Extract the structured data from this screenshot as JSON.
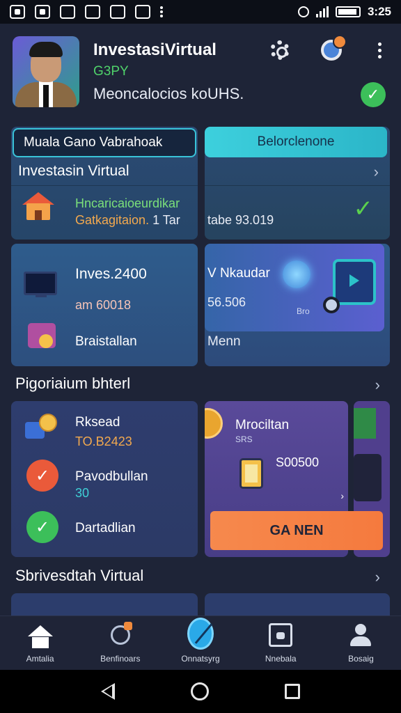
{
  "status_bar": {
    "time": "3:25"
  },
  "header": {
    "title": "InvestasiVirtual",
    "subtitle": "G3PY",
    "description": "Meoncalocios koUHS."
  },
  "cards": {
    "top_left": {
      "pill": "Muala Gano Vabrahoak",
      "title": "Investasin Virtual",
      "line1": "Hncaricaioeurdikar",
      "line2": "Gatkagitaion.",
      "line2_tail": "1 Tar"
    },
    "top_right": {
      "pill": "Belorclenone",
      "overflow": "tabe 93.019"
    },
    "mid_left": {
      "title": "Inves.2400",
      "value": "am 60018",
      "bottom": "Braistallan"
    },
    "mid_right": {
      "title": "V Nkaudar",
      "value": "56.506",
      "small": "Bro",
      "bottom": "Menn"
    }
  },
  "sections": {
    "section1": "Pigoriaium bhterl",
    "section2": "Sbrivesdtah Virtual"
  },
  "lower_cards": {
    "left": {
      "row1_title": "Rksead",
      "row1_value": "TO.B2423",
      "row2_title": "Pavodbullan",
      "row2_value": "30",
      "row3_title": "Dartadlian"
    },
    "middle": {
      "title": "Mrociltan",
      "small": "SRS",
      "value": "S00500"
    },
    "cta": "GA NEN"
  },
  "bottom_nav": [
    {
      "label": "Amtalia",
      "icon": "home-icon"
    },
    {
      "label": "Benfinoars",
      "icon": "rocket-icon"
    },
    {
      "label": "Onnatsyrg",
      "icon": "globe-icon"
    },
    {
      "label": "Nnebala",
      "icon": "wallet-icon"
    },
    {
      "label": "Bosaig",
      "icon": "profile-icon"
    }
  ],
  "colors": {
    "accent_cyan": "#3dd0dd",
    "accent_green": "#4fd26a",
    "accent_orange": "#f57a3e",
    "background": "#1e2437"
  }
}
